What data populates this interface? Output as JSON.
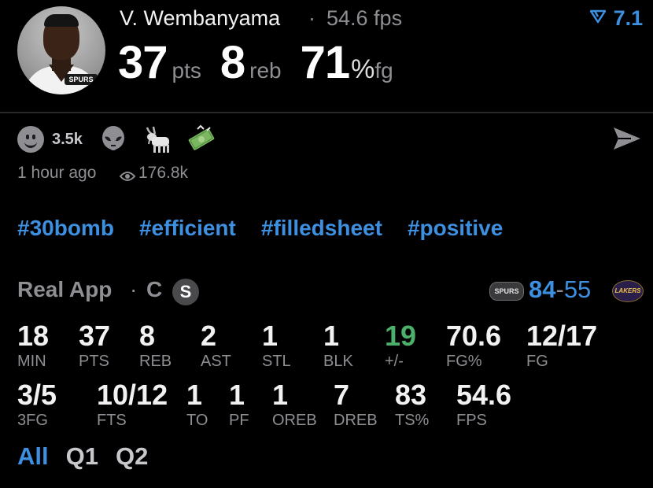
{
  "player": {
    "name": "V. Wembanyama",
    "fps_text": "54.6 fps",
    "separator": "·",
    "rating_value": "7.1",
    "jersey_text": "SPURS"
  },
  "headline": {
    "pts_value": "37",
    "pts_unit": "pts",
    "reb_value": "8",
    "reb_unit": "reb",
    "fg_value": "71",
    "fg_pct": "%",
    "fg_unit": "fg"
  },
  "reactions": {
    "count": "3.5k",
    "icons": [
      "smile-icon",
      "alien-icon",
      "goat-icon",
      "money-icon"
    ]
  },
  "meta": {
    "time": "1 hour ago",
    "views": "176.8k"
  },
  "tags": [
    "#30bomb",
    "#efficient",
    "#filledsheet",
    "#positive"
  ],
  "game": {
    "app_label": "Real App",
    "dot": "·",
    "position": "C",
    "badge": "S",
    "home_logo": "SPURS",
    "home_score": "84",
    "dash": "-",
    "away_score": "55",
    "away_logo": "LAKERS",
    "accent_color": "#3d8fe0",
    "positive_color": "#4caf6a"
  },
  "stats_row1": [
    {
      "value": "18",
      "label": "MIN"
    },
    {
      "value": "37",
      "label": "PTS"
    },
    {
      "value": "8",
      "label": "REB"
    },
    {
      "value": "2",
      "label": "AST"
    },
    {
      "value": "1",
      "label": "STL"
    },
    {
      "value": "1",
      "label": "BLK"
    },
    {
      "value": "19",
      "label": "+/-"
    },
    {
      "value": "70.6",
      "label": "FG%"
    },
    {
      "value": "12/17",
      "label": "FG"
    }
  ],
  "stats_row2": [
    {
      "value": "3/5",
      "label": "3FG"
    },
    {
      "value": "10/12",
      "label": "FTS"
    },
    {
      "value": "1",
      "label": "TO"
    },
    {
      "value": "1",
      "label": "PF"
    },
    {
      "value": "1",
      "label": "OREB"
    },
    {
      "value": "7",
      "label": "DREB"
    },
    {
      "value": "83",
      "label": "TS%"
    },
    {
      "value": "54.6",
      "label": "FPS"
    }
  ],
  "tabs": [
    "All",
    "Q1",
    "Q2"
  ]
}
